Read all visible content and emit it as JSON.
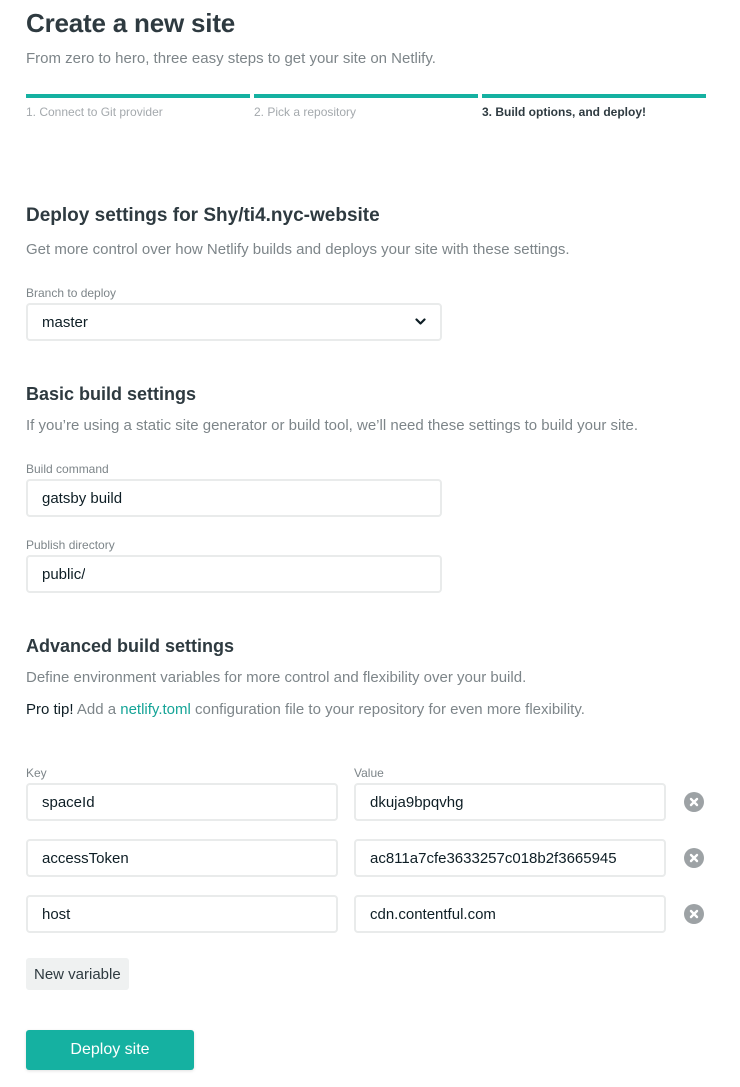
{
  "header": {
    "title": "Create a new site",
    "subtitle": "From zero to hero, three easy steps to get your site on Netlify."
  },
  "steps": [
    {
      "label": "1. Connect to Git provider",
      "completed": true,
      "active": false
    },
    {
      "label": "2. Pick a repository",
      "completed": true,
      "active": false
    },
    {
      "label": "3. Build options, and deploy!",
      "completed": true,
      "active": true
    }
  ],
  "deploy_settings": {
    "title": "Deploy settings for Shy/ti4.nyc-website",
    "description": "Get more control over how Netlify builds and deploys your site with these settings.",
    "branch_label": "Branch to deploy",
    "branch_value": "master"
  },
  "basic_build": {
    "title": "Basic build settings",
    "description": "If you’re using a static site generator or build tool, we’ll need these settings to build your site.",
    "build_command_label": "Build command",
    "build_command_value": "gatsby build",
    "publish_dir_label": "Publish directory",
    "publish_dir_value": "public/"
  },
  "advanced_build": {
    "title": "Advanced build settings",
    "description": "Define environment variables for more control and flexibility over your build.",
    "pro_tip_label": "Pro tip!",
    "pro_tip_before": " Add a ",
    "pro_tip_link": "netlify.toml",
    "pro_tip_after": " configuration file to your repository for even more flexibility.",
    "key_header": "Key",
    "value_header": "Value",
    "variables": [
      {
        "key": "spaceId",
        "value": "dkuja9bpqvhg"
      },
      {
        "key": "accessToken",
        "value": "ac811a7cfe3633257c018b2f3665945"
      },
      {
        "key": "host",
        "value": "cdn.contentful.com"
      }
    ],
    "new_variable_label": "New variable"
  },
  "actions": {
    "deploy_label": "Deploy site"
  },
  "colors": {
    "accent": "#15b1a1",
    "link": "#15a497",
    "heading": "#2e3a40",
    "muted": "#7d8589"
  },
  "icons": {
    "select_chevron": "chevron-down-icon",
    "remove_variable": "close-circle-icon"
  }
}
